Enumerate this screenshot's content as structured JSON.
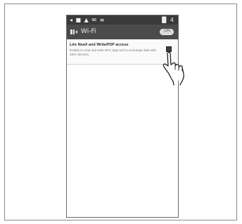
{
  "status_bar": {
    "left_icons": "◂ ■ ▲ ✉ ≡",
    "right_text": "▐▌ 4"
  },
  "action_bar": {
    "title": "Wi-Fi",
    "toggle_label": "ON"
  },
  "setting": {
    "title": "Lire NeaX and Write/P2P access",
    "description": "Enable to read and write NFC tags and to exchange data with other devices."
  },
  "icons": {
    "back": "back-arrow-icon",
    "hand": "pointing-hand-icon"
  },
  "colors": {
    "status_bar": "#3a3a3a",
    "action_bar": "#4b4b4b",
    "checkbox": "#3d3d3d"
  }
}
